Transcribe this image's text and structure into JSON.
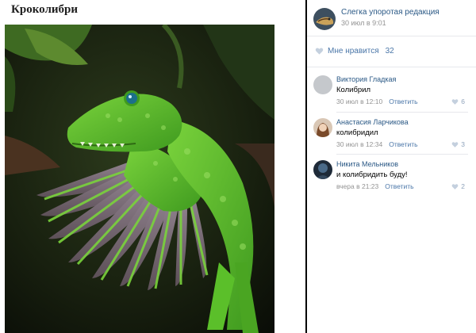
{
  "post": {
    "title": "Кроколибри",
    "image_alt": "crocodile-hummingbird hybrid on dark green foliage"
  },
  "author": {
    "name": "Слегка упоротая редакция",
    "timestamp": "30 июл в 9:01"
  },
  "likes": {
    "label": "Мне нравится",
    "count": "32"
  },
  "comments": [
    {
      "name": "Виктория Гладкая",
      "text": "Колибрил",
      "time": "30 июл в 12:10",
      "reply": "Ответить",
      "likes": "6"
    },
    {
      "name": "Анастасия Ларчикова",
      "text": "колибридил",
      "time": "30 июл в 12:34",
      "reply": "Ответить",
      "likes": "3"
    },
    {
      "name": "Никита Мельников",
      "text": "и колибридить буду!",
      "time": "вчера в 21:23",
      "reply": "Ответить",
      "likes": "2"
    }
  ],
  "colors": {
    "link": "#2a5885",
    "accent": "#4a76a8",
    "meta": "#939393",
    "croc_green": "#5bbf2a"
  },
  "icons": [
    "heart-icon"
  ]
}
